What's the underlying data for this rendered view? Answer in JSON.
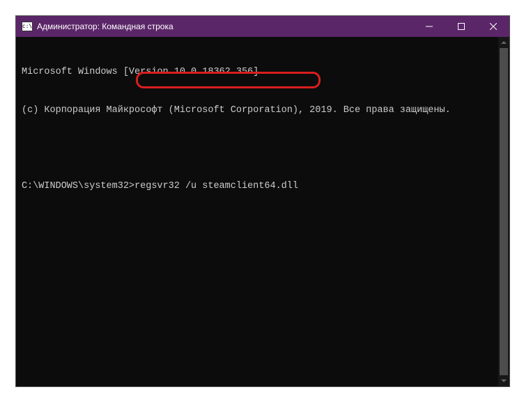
{
  "titlebar": {
    "icon_label": "CMD",
    "title": "Администратор: Командная строка"
  },
  "terminal": {
    "line1": "Microsoft Windows [Version 10.0.18362.356]",
    "line2": "(c) Корпорация Майкрософт (Microsoft Corporation), 2019. Все права защищены.",
    "prompt": "C:\\WINDOWS\\system32>",
    "command": "regsvr32 /u steamclient64.dll"
  }
}
